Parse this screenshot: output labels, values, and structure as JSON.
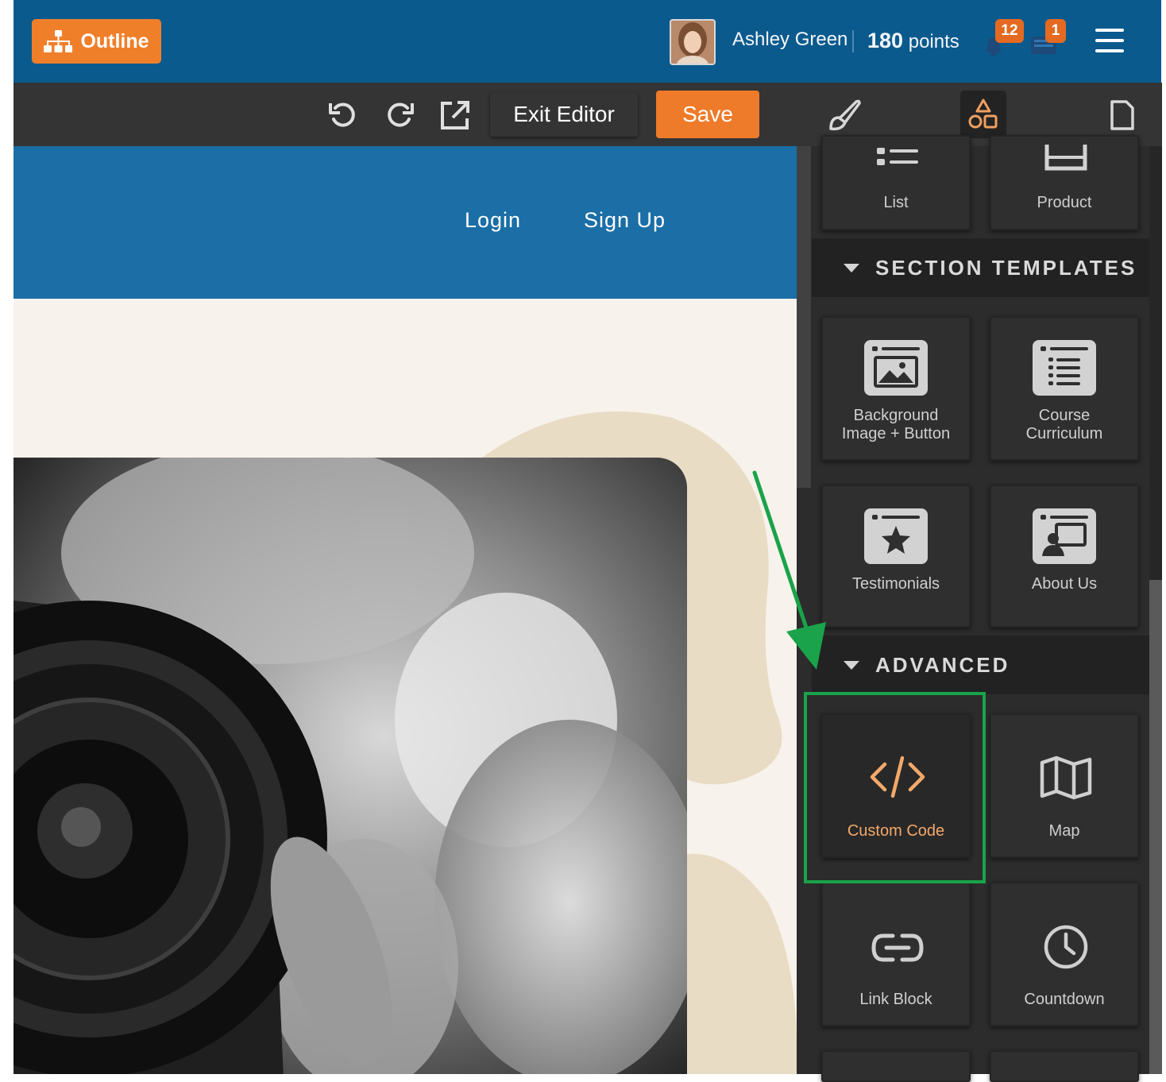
{
  "topbar": {
    "outline_label": "Outline",
    "user_name": "Ashley Green",
    "points_value": "180",
    "points_label": "points",
    "notifications_count": "12",
    "messages_count": "1"
  },
  "toolbar": {
    "exit_label": "Exit Editor",
    "save_label": "Save"
  },
  "site": {
    "nav": [
      "Login",
      "Sign Up"
    ]
  },
  "sidebar": {
    "top_blocks": [
      "List",
      "Product"
    ],
    "section_templates": {
      "title": "SECTION TEMPLATES",
      "items": [
        {
          "line1": "Background",
          "line2": "Image + Button"
        },
        {
          "line1": "Course",
          "line2": "Curriculum"
        },
        {
          "line1": "Testimonials"
        },
        {
          "line1": "About Us"
        }
      ]
    },
    "advanced": {
      "title": "ADVANCED",
      "items": [
        "Custom Code",
        "Map",
        "Link Block",
        "Countdown"
      ]
    }
  },
  "colors": {
    "brand_blue": "#0b5a8e",
    "accent_orange": "#ee7b29",
    "highlight_green": "#1aa34a"
  }
}
